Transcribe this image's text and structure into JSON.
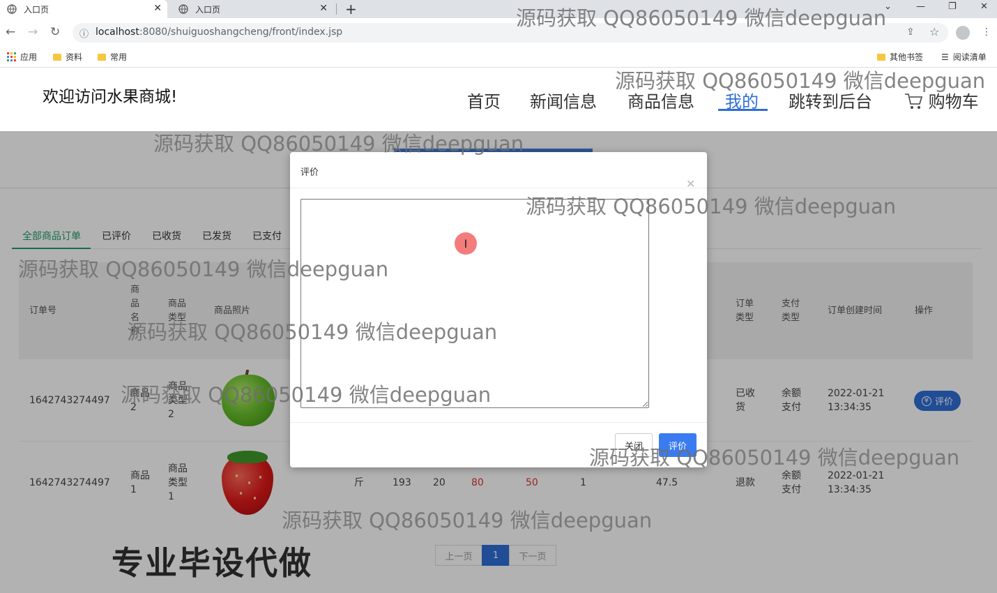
{
  "browser": {
    "tabs": [
      {
        "title": "入口页"
      },
      {
        "title": "入口页"
      }
    ],
    "url_host": "localhost",
    "url_rest": ":8080/shuiguoshangcheng/front/index.jsp",
    "bookmarks": [
      "应用",
      "资料",
      "常用"
    ],
    "bookmarks_right": [
      "其他书签",
      "阅读清单"
    ]
  },
  "header": {
    "welcome": "欢迎访问水果商城!",
    "nav": [
      "首页",
      "新闻信息",
      "商品信息",
      "我的",
      "跳转到后台",
      "购物车"
    ],
    "active_nav": "我的"
  },
  "order_tabs": [
    "全部商品订单",
    "已评价",
    "已收货",
    "已发货",
    "已支付"
  ],
  "table": {
    "headers": {
      "order_no": "订单号",
      "goods_name": "商品名称",
      "goods_type": "商品类型",
      "goods_photo": "商品照片",
      "order_type": "订单类型",
      "pay_type": "支付类型",
      "created": "订单创建时间",
      "action": "操作"
    },
    "rows": [
      {
        "order_no": "1642743274497",
        "goods_name": "商品2",
        "goods_type": "商品类型2",
        "order_type": "已收货",
        "pay_type": "余额支付",
        "created_date": "2022-01-21",
        "created_time": "13:34:35",
        "action_label": "评价"
      },
      {
        "order_no": "1642743274497",
        "goods_name": "商品1",
        "goods_type": "商品类型1",
        "unit": "斤",
        "c1": "193",
        "c2": "20",
        "c3": "80",
        "c4": "50",
        "c5": "1",
        "c6": "47.5",
        "order_type": "退款",
        "pay_type": "余额支付",
        "created_date": "2022-01-21",
        "created_time": "13:34:35"
      }
    ]
  },
  "pagination": {
    "prev": "上一页",
    "current": "1",
    "next": "下一页"
  },
  "modal": {
    "title": "评价",
    "textarea_value": "",
    "close_label": "关闭",
    "submit_label": "评价"
  },
  "watermark": "源码获取 QQ86050149 微信deepguan",
  "promo": "专业毕设代做",
  "colors": {
    "accent": "#2f6fd6",
    "green_tab": "#1e9e6a",
    "price_red": "#d33"
  }
}
